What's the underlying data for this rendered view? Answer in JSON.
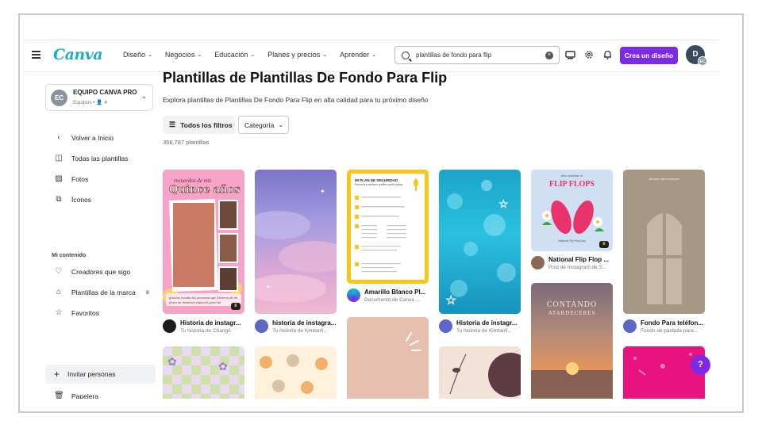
{
  "header": {
    "logo": "Canva",
    "nav": [
      {
        "label": "Diseño",
        "has_chevron": true
      },
      {
        "label": "Negocios",
        "has_chevron": true
      },
      {
        "label": "Educación",
        "has_chevron": true
      },
      {
        "label": "Planes y precios",
        "has_chevron": true
      },
      {
        "label": "Aprender",
        "has_chevron": true
      }
    ],
    "search_value": "plantillas de fondo para flip",
    "create_button": "Crea un diseño",
    "avatar_initial": "D",
    "avatar_badge": "EC"
  },
  "sidebar": {
    "team_initials": "EC",
    "team_name": "EQUIPO CANVA PRO",
    "team_sub": "Equipos • 👤 4",
    "items": [
      {
        "label": "Volver a Inicio",
        "icon": "chevron-left-icon"
      },
      {
        "label": "Todas las plantillas",
        "icon": "templates-icon"
      },
      {
        "label": "Fotos",
        "icon": "photo-icon"
      },
      {
        "label": "Íconos",
        "icon": "shapes-icon"
      }
    ],
    "section_label": "Mi contenido",
    "content_items": [
      {
        "label": "Creadores que sigo",
        "icon": "heart-hands-icon"
      },
      {
        "label": "Plantillas de la marca",
        "icon": "brand-icon"
      },
      {
        "label": "Favoritos",
        "icon": "star-icon"
      }
    ],
    "invite_label": "Invitar personas",
    "trash_label": "Papelera"
  },
  "main": {
    "title": "Plantillas de Plantillas De Fondo Para Flip",
    "subtitle": "Explora plantillas de Plantillas De Fondo Para Flip en alta calidad para tu próximo diseño",
    "filter_label": "Todos los filtros",
    "category_label": "Categoría",
    "count": "356,787 plantillas",
    "cards": [
      {
        "title": "Historia de instagr...",
        "subtitle": "Tu historia de Changö",
        "text_top": "recuerdos de mis",
        "text_main": "Quince años",
        "text_bottom": "gracias a todas las personas que hicieron de mi fiesta un momento especial, para mí"
      },
      {
        "title": "historia de instagra...",
        "subtitle": "Tu historia de Kimberli..."
      },
      {
        "title": "Amarillo Blanco Pl...",
        "subtitle": "Documento de Canva ...",
        "doc_title": "MI PLAN DE SEGURIDAD",
        "doc_sub": "Recuerda siempre puedes pedir ayuda"
      },
      {
        "title": "Historia de instagr...",
        "subtitle": "Tu historia de Kimberli..."
      },
      {
        "title": "National Flip Flop ...",
        "subtitle": "Post de Instagram de S...",
        "art_top": "feliz celebrar el",
        "art_main": "FLIP FLOPS",
        "art_bottom": "National Flip Flop Day"
      },
      {
        "title": "Fondo Para teléfon...",
        "subtitle": "Fondo de pantalla para...",
        "art_top": "Siempre para siempre"
      },
      {
        "art_main": "CONTANDO",
        "art_sub": "ATARDECERES"
      }
    ]
  },
  "help_label": "?"
}
